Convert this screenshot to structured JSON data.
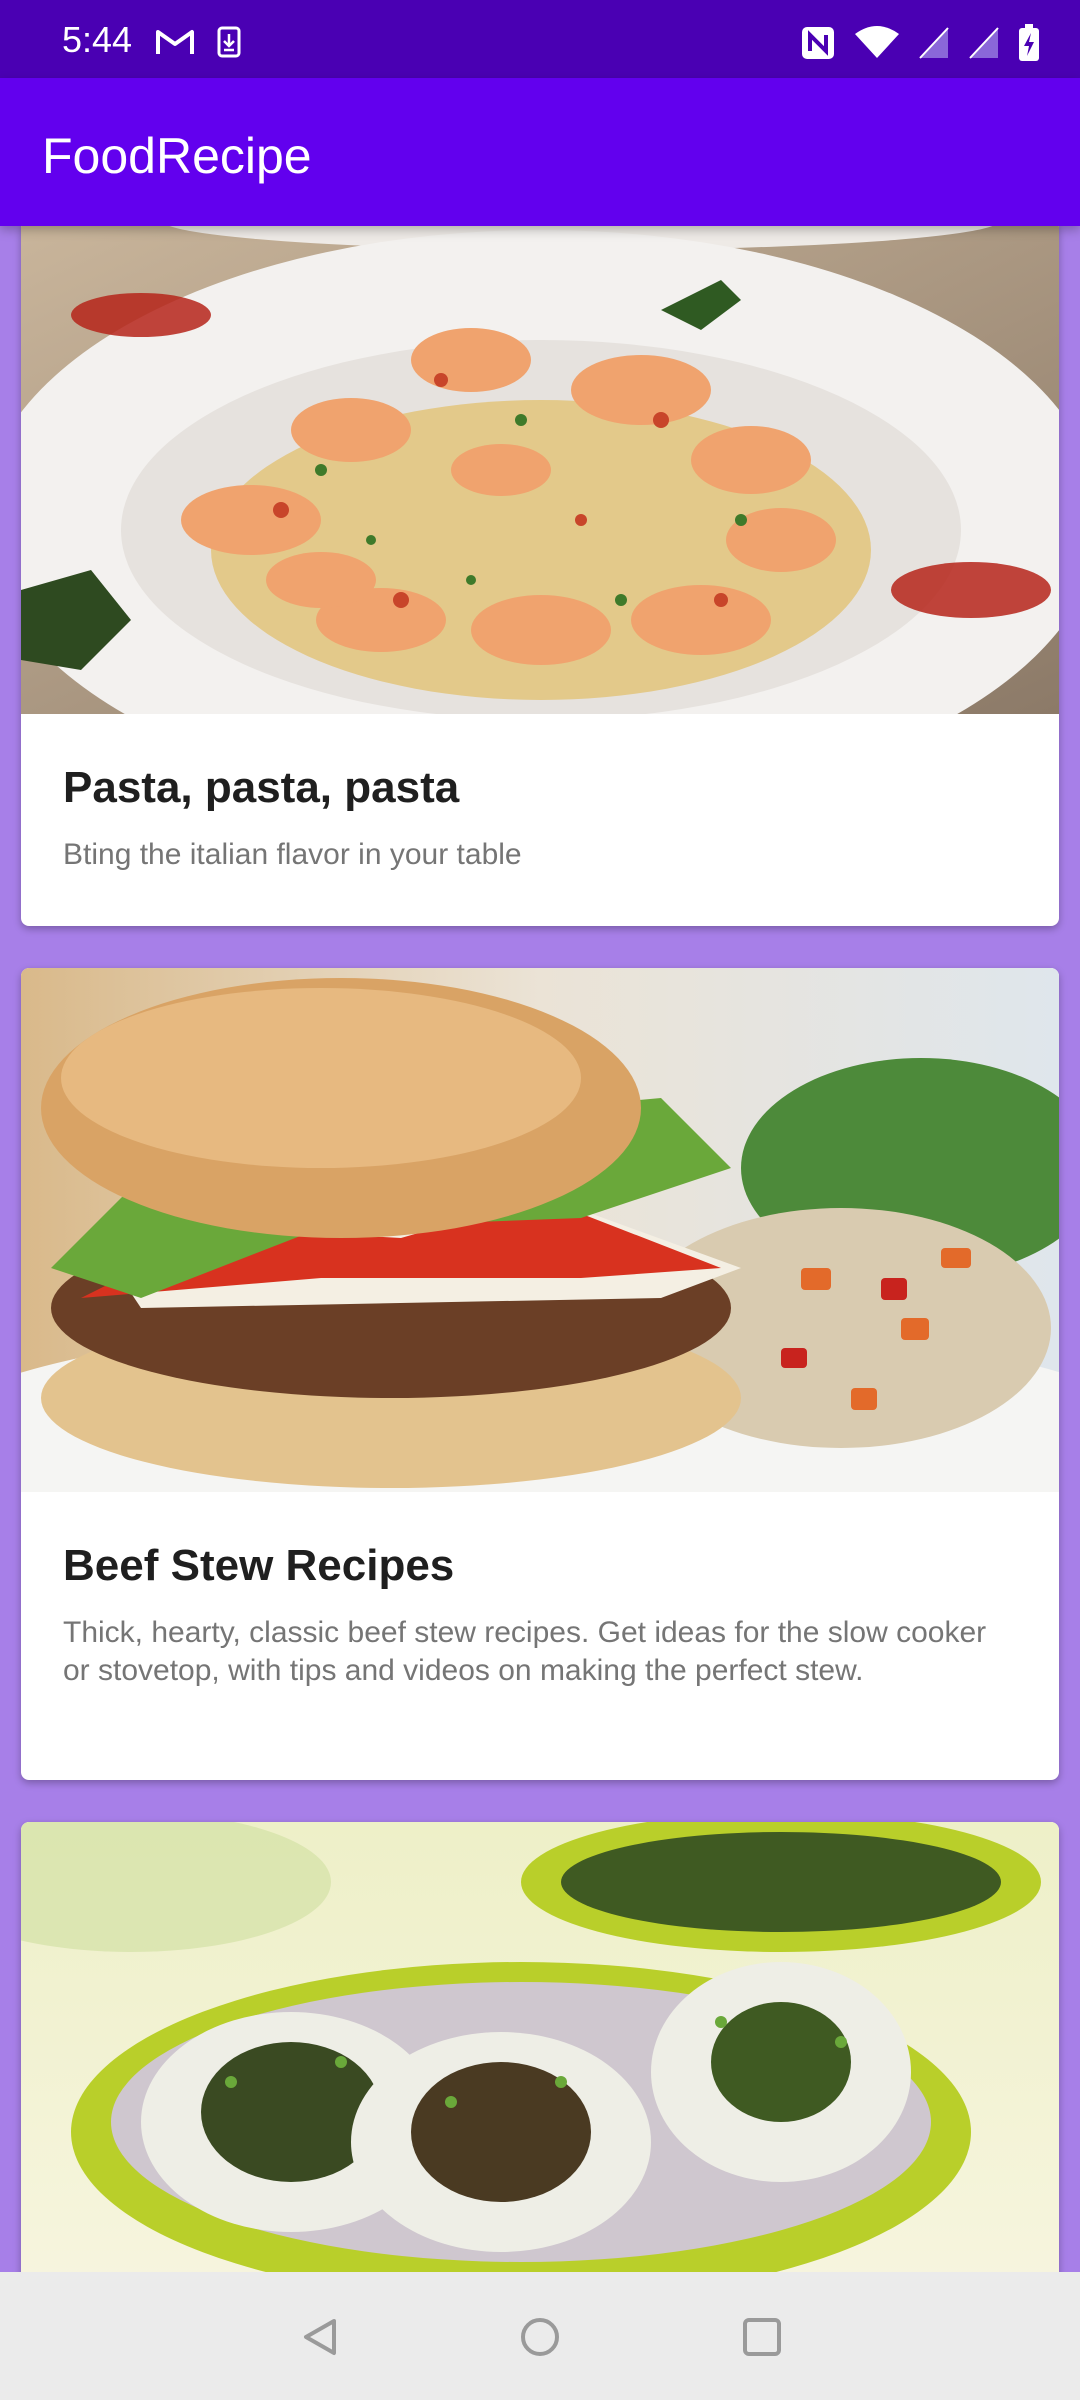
{
  "status_bar": {
    "time": "5:44",
    "left_icons": [
      "gmail-icon",
      "download-icon"
    ],
    "right_icons": [
      "nfc-icon",
      "wifi-icon",
      "signal-icon",
      "signal-2-icon",
      "battery-icon"
    ],
    "bg_color": "#4a00b3"
  },
  "app_bar": {
    "title": "FoodRecipe",
    "bg_color": "#6200ee"
  },
  "feed": {
    "bg_color": "#a77fe8",
    "cards": [
      {
        "title": "Pasta, pasta, pasta",
        "description": "Bting the italian flavor in your table",
        "image": "shrimp-pasta-photo"
      },
      {
        "title": "Beef Stew Recipes",
        "description": "Thick, hearty, classic beef stew recipes. Get ideas for the slow cooker or stovetop, with tips and videos on making the perfect stew.",
        "image": "burger-photo"
      },
      {
        "title": "",
        "description": "",
        "image": "sushi-roll-photo"
      }
    ]
  },
  "nav_bar": {
    "buttons": [
      "back-icon",
      "home-icon",
      "recents-icon"
    ]
  }
}
